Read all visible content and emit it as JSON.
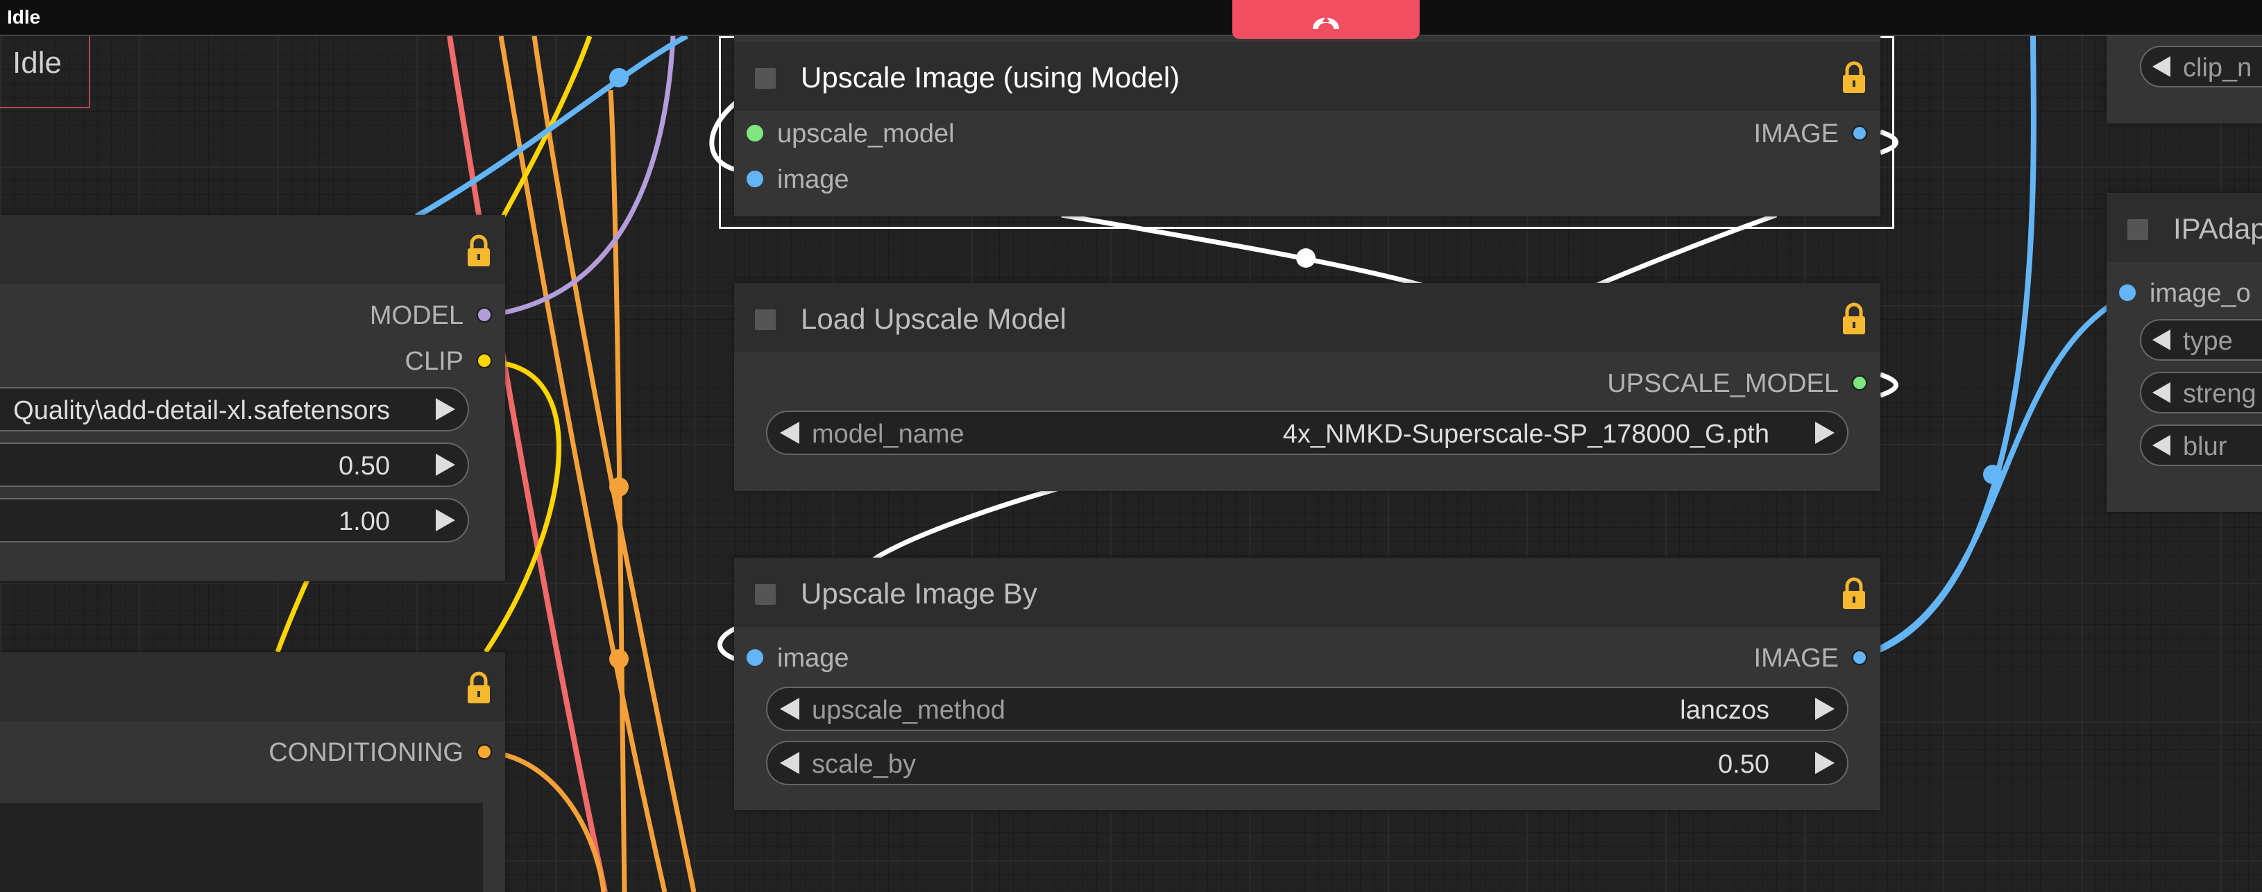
{
  "window": {
    "title": "Idle"
  },
  "status_overlay": "Idle",
  "colors": {
    "model": "#b39ddb",
    "clip": "#ffd500",
    "conditioning": "#ffa931",
    "image": "#64b5f6",
    "upscale_model": "#7ee67e",
    "accent_tab": "#f24e61",
    "lock": "#f5b82e"
  },
  "left_nodes": {
    "lora": {
      "outputs": [
        "MODEL",
        "CLIP"
      ],
      "widgets": [
        {
          "value": "Quality\\add-detail-xl.safetensors"
        },
        {
          "value": "0.50"
        },
        {
          "value": "1.00"
        }
      ]
    },
    "text_encode": {
      "output": "CONDITIONING"
    }
  },
  "nodes": {
    "upscale_with_model": {
      "title": "Upscale Image (using Model)",
      "inputs": [
        "upscale_model",
        "image"
      ],
      "output": "IMAGE"
    },
    "load_upscale_model": {
      "title": "Load Upscale Model",
      "output": "UPSCALE_MODEL",
      "widget": {
        "label": "model_name",
        "value": "4x_NMKD-Superscale-SP_178000_G.pth"
      }
    },
    "upscale_image_by": {
      "title": "Upscale Image By",
      "input": "image",
      "output": "IMAGE",
      "widgets": [
        {
          "label": "upscale_method",
          "value": "lanczos"
        },
        {
          "label": "scale_by",
          "value": "0.50"
        }
      ]
    }
  },
  "right_nodes": {
    "top_widget": "clip_n",
    "ipadapter": {
      "title": "IPAdap",
      "input": "image_o",
      "widgets": [
        "type",
        "streng",
        "blur"
      ]
    }
  }
}
